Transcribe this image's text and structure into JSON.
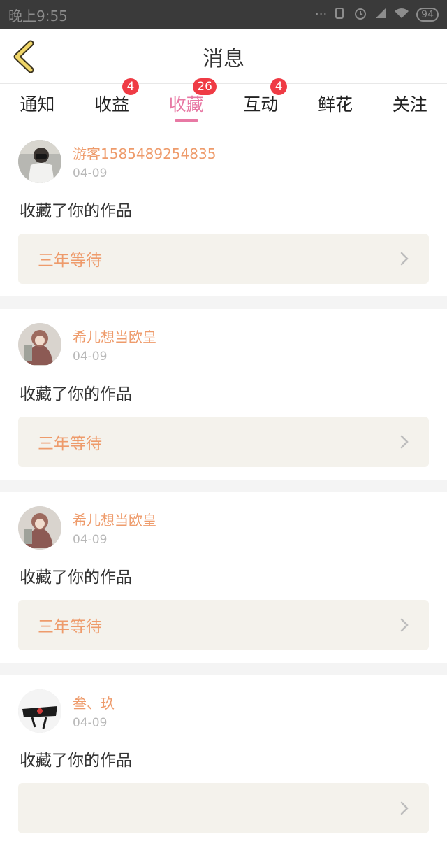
{
  "status_bar": {
    "time": "晚上9:55",
    "battery": "94"
  },
  "header": {
    "title": "消息"
  },
  "tabs": [
    {
      "label": "通知",
      "badge": ""
    },
    {
      "label": "收益",
      "badge": "4"
    },
    {
      "label": "收藏",
      "badge": "26",
      "active": true
    },
    {
      "label": "互动",
      "badge": "4"
    },
    {
      "label": "鲜花",
      "badge": ""
    },
    {
      "label": "关注",
      "badge": ""
    }
  ],
  "items": [
    {
      "username": "游客1585489254835",
      "date": "04-09",
      "action": "收藏了你的作品",
      "work": "三年等待",
      "avatar": "avatar-photo-masked"
    },
    {
      "username": "希儿想当欧皇",
      "date": "04-09",
      "action": "收藏了你的作品",
      "work": "三年等待",
      "avatar": "avatar-anime-girl"
    },
    {
      "username": "希儿想当欧皇",
      "date": "04-09",
      "action": "收藏了你的作品",
      "work": "三年等待",
      "avatar": "avatar-anime-girl"
    },
    {
      "username": "叁、玖",
      "date": "04-09",
      "action": "收藏了你的作品",
      "work": "",
      "avatar": "avatar-love-graphic"
    }
  ],
  "colors": {
    "accent": "#e879a4",
    "name": "#ee9b6b",
    "badge": "#ef3b45"
  }
}
